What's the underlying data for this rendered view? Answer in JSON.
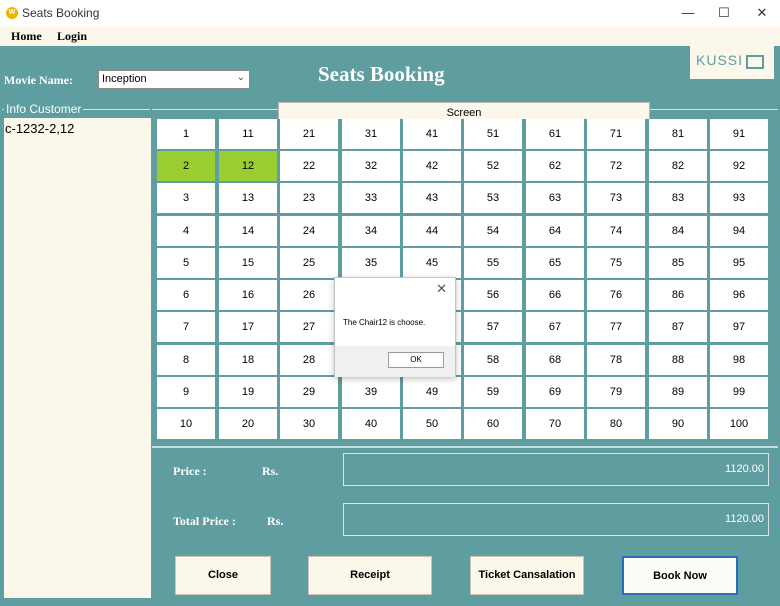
{
  "window": {
    "icon_text": "W",
    "title": "Seats Booking",
    "minimize": "—",
    "maximize": "☐",
    "close": "✕"
  },
  "menu": {
    "home": "Home",
    "login": "Login"
  },
  "header": {
    "movie_label": "Movie Name:",
    "movie_selected": "Inception",
    "page_title": "Seats Booking",
    "logo_text": "KUSSI"
  },
  "info": {
    "legend": "Info Customer",
    "content": "c-1232-2,12"
  },
  "screen_label": "Screen",
  "seats": {
    "selected": [
      2,
      12
    ],
    "selected_color": "#9acd32"
  },
  "pricing": {
    "price_label": "Price     :",
    "price_currency": "Rs.",
    "price_value": "1120.00",
    "total_label": "Total Price   :",
    "total_currency": "Rs.",
    "total_value": "1120.00"
  },
  "buttons": {
    "close": "Close",
    "receipt": "Receipt",
    "cancel": "Ticket Cansalation",
    "book": "Book Now"
  },
  "dialog": {
    "close_glyph": "✕",
    "message": "The Chair12 is choose.",
    "ok": "OK"
  },
  "colors": {
    "panel": "#5f9ea0",
    "cream": "#fbf7ea",
    "selected": "#9acd32",
    "accent_border": "#2b6fb6"
  }
}
